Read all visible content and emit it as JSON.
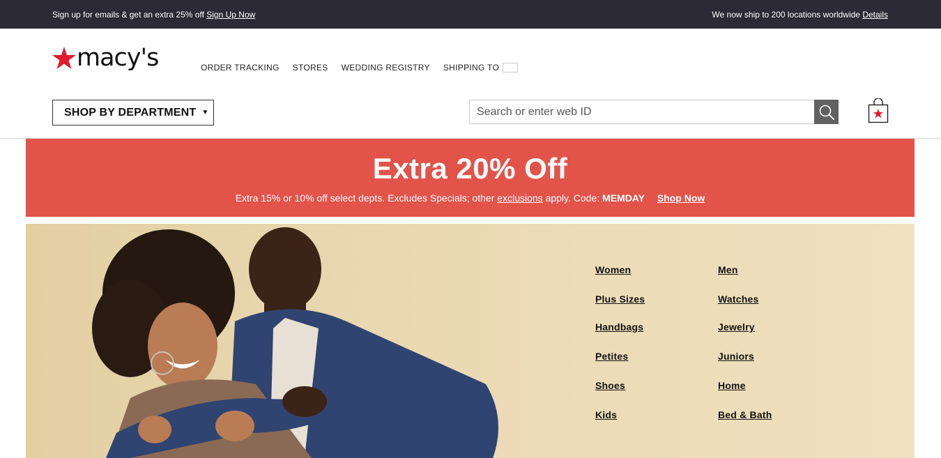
{
  "topbar": {
    "left_text": "Sign up for emails & get an extra 25% off",
    "left_link": "Sign Up Now",
    "right_text": "We now ship to 200 locations worldwide",
    "right_link": "Details"
  },
  "header": {
    "logo_text": "macy's",
    "utility_nav": [
      "ORDER TRACKING",
      "STORES",
      "WEDDING REGISTRY",
      "SHIPPING TO"
    ],
    "shipping_flag": "bulgaria-flag",
    "dept_button": "SHOP BY DEPARTMENT",
    "search_placeholder": "Search or enter web ID",
    "search_icon": "search-icon",
    "bag_icon": "shopping-bag-icon"
  },
  "banner": {
    "headline": "Extra 20% Off",
    "sub_before": "Extra 15% or 10% off select depts. Excludes Specials; other",
    "sub_link": "exclusions",
    "sub_after": "apply. Code:",
    "code": "MEMDAY",
    "cta": "Shop Now"
  },
  "hero": {
    "categories_left": [
      "Women",
      "Plus Sizes",
      "Handbags",
      "Petites",
      "Shoes",
      "Kids"
    ],
    "categories_right": [
      "Men",
      "Watches",
      "Jewelry",
      "Juniors",
      "Home",
      "Bed & Bath"
    ]
  },
  "colors": {
    "topbar": "#2b2a35",
    "banner": "#e2534a",
    "brand_star": "#e21a2c",
    "search_button": "#616161"
  }
}
